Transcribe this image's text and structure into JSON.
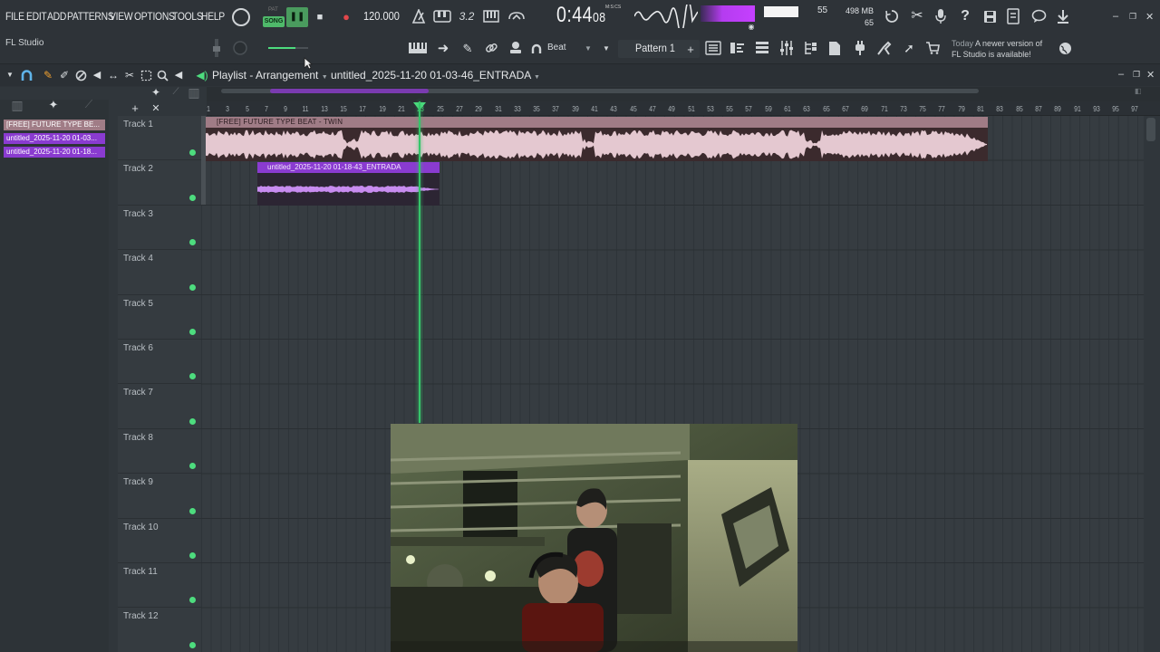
{
  "menu": [
    "FILE",
    "EDIT",
    "ADD",
    "PATTERNS",
    "VIEW",
    "OPTIONS",
    "TOOLS",
    "HELP"
  ],
  "app_name": "FL Studio",
  "transport": {
    "pat_label": "PAT",
    "song_label": "SONG",
    "tempo": "120.000",
    "time_main": "0:44",
    "time_small": "08",
    "time_unit": "M:S:CS"
  },
  "monitor": {
    "cpu": "55",
    "memory": "498 MB",
    "polyphony": "65"
  },
  "pattern": {
    "snap": "Beat",
    "name": "Pattern 1",
    "add": "+"
  },
  "news": {
    "when": "Today",
    "line1": "A newer version of",
    "line2": "FL Studio is available!"
  },
  "playlist": {
    "title": "Playlist - Arrangement",
    "file": "untitled_2025-11-20 01-03-46_ENTRADA"
  },
  "picker": [
    "[FREE] FUTURE TYPE BE...",
    "untitled_2025-11-20 01-03...",
    "untitled_2025-11-20 01-18..."
  ],
  "tracks": [
    "Track 1",
    "Track 2",
    "Track 3",
    "Track 4",
    "Track 5",
    "Track 6",
    "Track 7",
    "Track 8",
    "Track 9",
    "Track 10",
    "Track 11",
    "Track 12"
  ],
  "ruler": [
    "1",
    "3",
    "5",
    "7",
    "9",
    "11",
    "13",
    "15",
    "17",
    "19",
    "21",
    "23",
    "25",
    "27",
    "29",
    "31",
    "33",
    "35",
    "37",
    "39",
    "41",
    "43",
    "45",
    "47",
    "49",
    "51",
    "53",
    "55",
    "57",
    "59",
    "61",
    "63",
    "65",
    "67",
    "69",
    "71",
    "73",
    "75",
    "77",
    "79",
    "81",
    "83",
    "85",
    "87",
    "89",
    "91",
    "93",
    "95",
    "97"
  ],
  "clips": [
    {
      "name": "[FREE] FUTURE TYPE BEAT - TWIN",
      "color": "#a07c86"
    },
    {
      "name": "untitled_2025-11-20 01-18-43_ENTRADA",
      "color": "#8a3bd0"
    }
  ],
  "colors": {
    "accent_green": "#4ddc7e",
    "clip_pink": "#a07c86",
    "clip_purple": "#8a3bd0"
  }
}
